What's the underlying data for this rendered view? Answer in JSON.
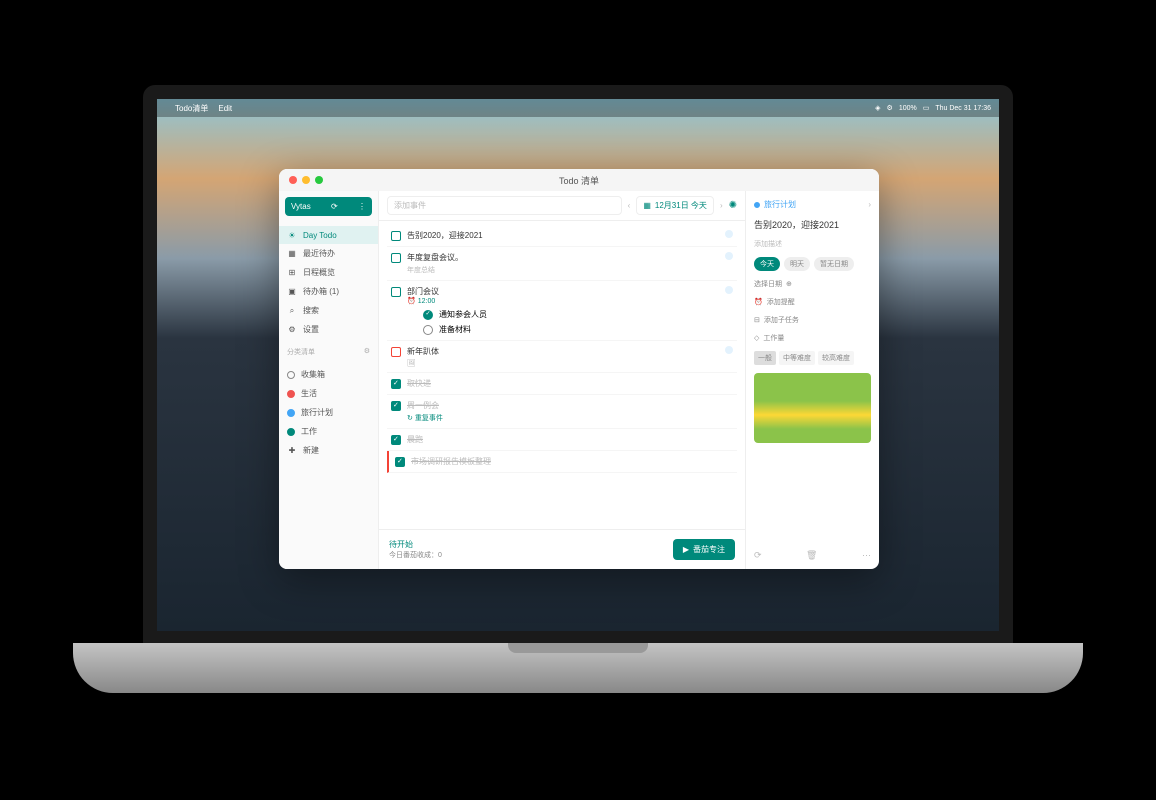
{
  "menubar": {
    "app": "Todo清单",
    "edit": "Edit",
    "battery": "100%",
    "datetime": "Thu Dec 31  17:36"
  },
  "window": {
    "title": "Todo 清单"
  },
  "sidebar": {
    "user": "Vytas",
    "nav": [
      {
        "icon": "sun",
        "label": "Day Todo"
      },
      {
        "icon": "cal",
        "label": "最近待办"
      },
      {
        "icon": "grid",
        "label": "日程概览"
      },
      {
        "icon": "box",
        "label": "待办箱  (1)"
      },
      {
        "icon": "search",
        "label": "搜索"
      },
      {
        "icon": "gear",
        "label": "设置"
      }
    ],
    "section": "分类清单",
    "lists": [
      {
        "color": "",
        "label": "收集箱"
      },
      {
        "color": "red",
        "label": "生活"
      },
      {
        "color": "blue",
        "label": "旅行计划"
      },
      {
        "color": "teal",
        "label": "工作"
      },
      {
        "icon": "plus",
        "label": "新建"
      }
    ]
  },
  "toolbar": {
    "placeholder": "添加事件",
    "date": "12月31日 今天"
  },
  "tasks": [
    {
      "cb": "",
      "title": "告别2020，迎接2021",
      "flag": true
    },
    {
      "cb": "",
      "title": "年度复盘会议。",
      "sub": "年度总结",
      "flag": true
    },
    {
      "cb": "",
      "title": "部门会议",
      "time": "12:00",
      "subtasks": [
        {
          "done": true,
          "label": "通知参会人员"
        },
        {
          "done": false,
          "label": "准备材料"
        }
      ],
      "flag": true
    },
    {
      "cb": "red",
      "title": "新年趴体",
      "img": true,
      "flag": true
    },
    {
      "cb": "chk",
      "title": "取快递",
      "done": true
    },
    {
      "cb": "chk",
      "title": "周一例会",
      "done": true,
      "repeat": "重复事件"
    },
    {
      "cb": "chk",
      "title": "晨跑",
      "done": true
    },
    {
      "cb": "chk",
      "title": "市场调研报告模板整理",
      "done": true,
      "sel": true
    }
  ],
  "detail": {
    "crumb": "旅行计划",
    "title": "告别2020，迎接2021",
    "desc": "添加描述",
    "chips": [
      "今天",
      "明天",
      "暂无日期"
    ],
    "dateRow": "选择日期",
    "reminder": "添加提醒",
    "subtask": "添加子任务",
    "effort": "工作量",
    "difficulty": [
      "一般",
      "中等难度",
      "较高难度"
    ]
  },
  "footer": {
    "status": "待开始",
    "harvest": "今日番茄收成：0",
    "button": "番茄专注"
  }
}
